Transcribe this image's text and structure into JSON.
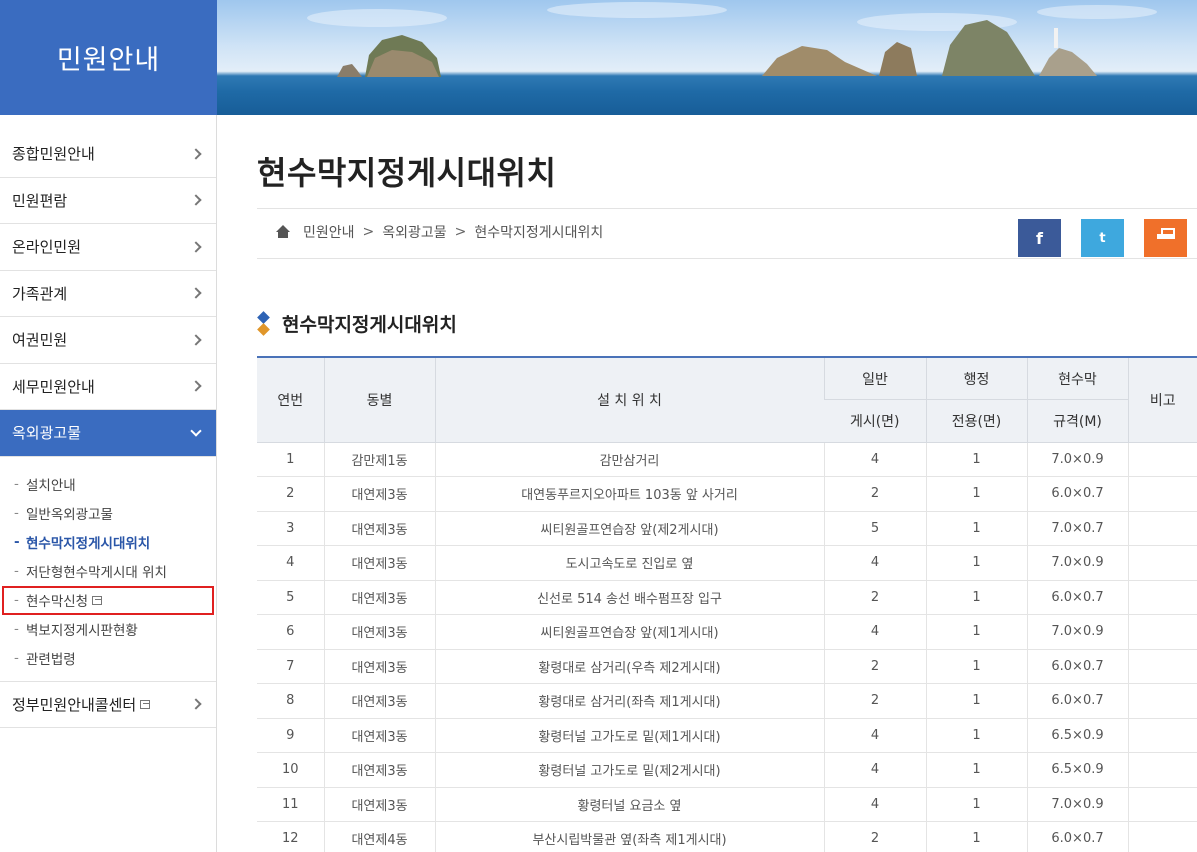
{
  "header": {
    "side_title": "민원안내"
  },
  "sidebar": {
    "items": [
      {
        "label": "종합민원안내"
      },
      {
        "label": "민원편람"
      },
      {
        "label": "온라인민원"
      },
      {
        "label": "가족관계"
      },
      {
        "label": "여권민원"
      },
      {
        "label": "세무민원안내"
      },
      {
        "label": "옥외광고물",
        "active": true
      }
    ],
    "submenu": [
      {
        "label": "설치안내"
      },
      {
        "label": "일반옥외광고물"
      },
      {
        "label": "현수막지정게시대위치",
        "current": true
      },
      {
        "label": "저단형현수막게시대 위치"
      },
      {
        "label": "현수막신청",
        "new_window": true,
        "highlighted": true
      },
      {
        "label": "벽보지정게시판현황"
      },
      {
        "label": "관련법령"
      }
    ],
    "last_item": {
      "label": "정부민원안내콜센터",
      "new_window": true
    }
  },
  "main": {
    "page_title": "현수막지정게시대위치",
    "breadcrumb": [
      "민원안내",
      "옥외광고물",
      "현수막지정게시대위치"
    ],
    "breadcrumb_sep": ">",
    "share": {
      "facebook": "f",
      "twitter": "t"
    },
    "section_title": "현수막지정게시대위치",
    "table": {
      "headers": {
        "no": "연번",
        "dong": "동별",
        "location": "설 치 위 치",
        "general_top": "일반",
        "general_bottom": "게시(면)",
        "admin_top": "행정",
        "admin_bottom": "전용(면)",
        "size_top": "현수막",
        "size_bottom": "규격(M)",
        "note": "비고"
      },
      "rows": [
        {
          "no": "1",
          "dong": "감만제1동",
          "location": "감만삼거리",
          "general": "4",
          "admin": "1",
          "size": "7.0×0.9",
          "note": ""
        },
        {
          "no": "2",
          "dong": "대연제3동",
          "location": "대연동푸르지오아파트 103동 앞 사거리",
          "general": "2",
          "admin": "1",
          "size": "6.0×0.7",
          "note": ""
        },
        {
          "no": "3",
          "dong": "대연제3동",
          "location": "씨티원골프연습장 앞(제2게시대)",
          "general": "5",
          "admin": "1",
          "size": "7.0×0.7",
          "note": ""
        },
        {
          "no": "4",
          "dong": "대연제3동",
          "location": "도시고속도로 진입로 옆",
          "general": "4",
          "admin": "1",
          "size": "7.0×0.9",
          "note": ""
        },
        {
          "no": "5",
          "dong": "대연제3동",
          "location": "신선로 514 송선 배수펌프장 입구",
          "general": "2",
          "admin": "1",
          "size": "6.0×0.7",
          "note": ""
        },
        {
          "no": "6",
          "dong": "대연제3동",
          "location": "씨티원골프연습장 앞(제1게시대)",
          "general": "4",
          "admin": "1",
          "size": "7.0×0.9",
          "note": ""
        },
        {
          "no": "7",
          "dong": "대연제3동",
          "location": "황령대로 삼거리(우측 제2게시대)",
          "general": "2",
          "admin": "1",
          "size": "6.0×0.7",
          "note": ""
        },
        {
          "no": "8",
          "dong": "대연제3동",
          "location": "황령대로 삼거리(좌측 제1게시대)",
          "general": "2",
          "admin": "1",
          "size": "6.0×0.7",
          "note": ""
        },
        {
          "no": "9",
          "dong": "대연제3동",
          "location": "황령터널 고가도로 밑(제1게시대)",
          "general": "4",
          "admin": "1",
          "size": "6.5×0.9",
          "note": ""
        },
        {
          "no": "10",
          "dong": "대연제3동",
          "location": "황령터널 고가도로 밑(제2게시대)",
          "general": "4",
          "admin": "1",
          "size": "6.5×0.9",
          "note": ""
        },
        {
          "no": "11",
          "dong": "대연제3동",
          "location": "황령터널 요금소 옆",
          "general": "4",
          "admin": "1",
          "size": "7.0×0.9",
          "note": ""
        },
        {
          "no": "12",
          "dong": "대연제4동",
          "location": "부산시립박물관 옆(좌측 제1게시대)",
          "general": "2",
          "admin": "1",
          "size": "6.0×0.7",
          "note": ""
        }
      ]
    }
  },
  "colors": {
    "primary": "#3a6cc0",
    "highlight": "#e02020",
    "facebook": "#3b5a99",
    "twitter": "#3ea8de",
    "print": "#f0702a"
  }
}
